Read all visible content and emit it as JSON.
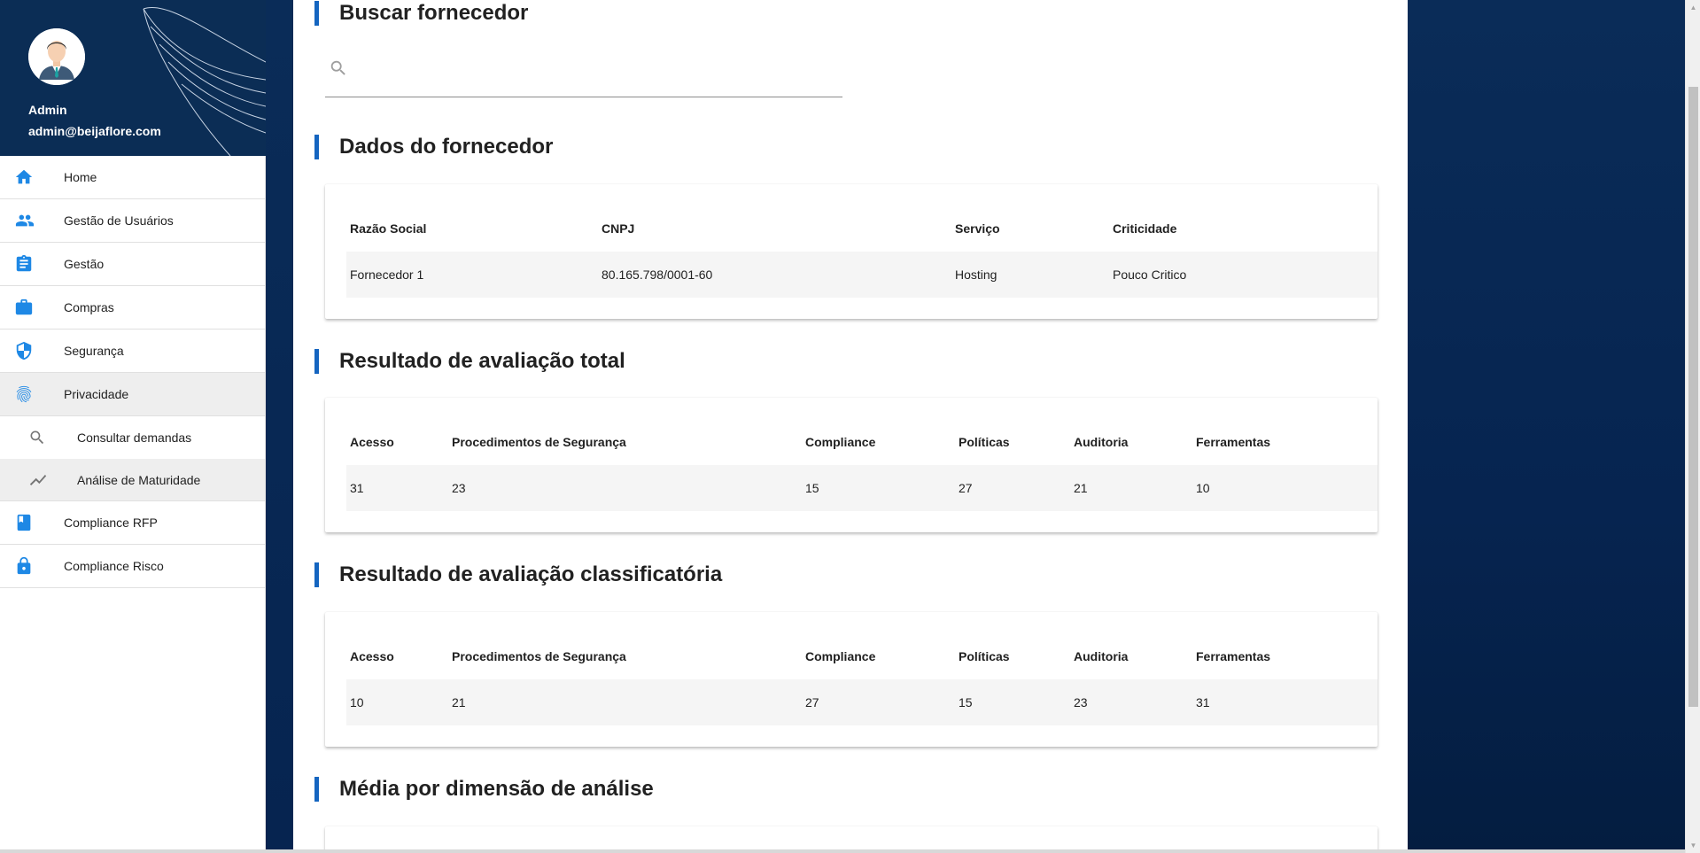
{
  "sidebar": {
    "user": {
      "name": "Admin",
      "email": "admin@beijaflore.com"
    },
    "items": [
      {
        "label": "Home",
        "icon": "home-icon"
      },
      {
        "label": "Gestão de Usuários",
        "icon": "users-icon"
      },
      {
        "label": "Gestão",
        "icon": "clipboard-icon"
      },
      {
        "label": "Compras",
        "icon": "briefcase-icon"
      },
      {
        "label": "Segurança",
        "icon": "shield-icon"
      },
      {
        "label": "Privacidade",
        "icon": "fingerprint-icon"
      }
    ],
    "subitems": [
      {
        "label": "Consultar demandas",
        "icon": "search-icon"
      },
      {
        "label": "Análise de Maturidade",
        "icon": "trending-icon"
      }
    ],
    "items_after": [
      {
        "label": "Compliance RFP",
        "icon": "book-icon"
      },
      {
        "label": "Compliance Risco",
        "icon": "lock-icon"
      }
    ],
    "accent": "#1e88e5"
  },
  "main": {
    "search": {
      "title": "Buscar fornecedor",
      "placeholder": ""
    },
    "supplier": {
      "title": "Dados do fornecedor",
      "headers": [
        "Razão Social",
        "CNPJ",
        "Serviço",
        "Criticidade"
      ],
      "row": [
        "Fornecedor 1",
        "80.165.798/0001-60",
        "Hosting",
        "Pouco Critico"
      ]
    },
    "total": {
      "title": "Resultado de avaliação total",
      "headers": [
        "Acesso",
        "Procedimentos de Segurança",
        "Compliance",
        "Políticas",
        "Auditoria",
        "Ferramentas"
      ],
      "row": [
        "31",
        "23",
        "15",
        "27",
        "21",
        "10"
      ]
    },
    "classificatoria": {
      "title": "Resultado de avaliação classificatória",
      "headers": [
        "Acesso",
        "Procedimentos de Segurança",
        "Compliance",
        "Políticas",
        "Auditoria",
        "Ferramentas"
      ],
      "row": [
        "10",
        "21",
        "27",
        "15",
        "23",
        "31"
      ]
    },
    "media": {
      "title": "Média por dimensão de análise"
    }
  },
  "colors": {
    "brand_dark": "#0b2d55",
    "title_bar": "#1565c0",
    "row_bg": "#f5f5f5"
  }
}
